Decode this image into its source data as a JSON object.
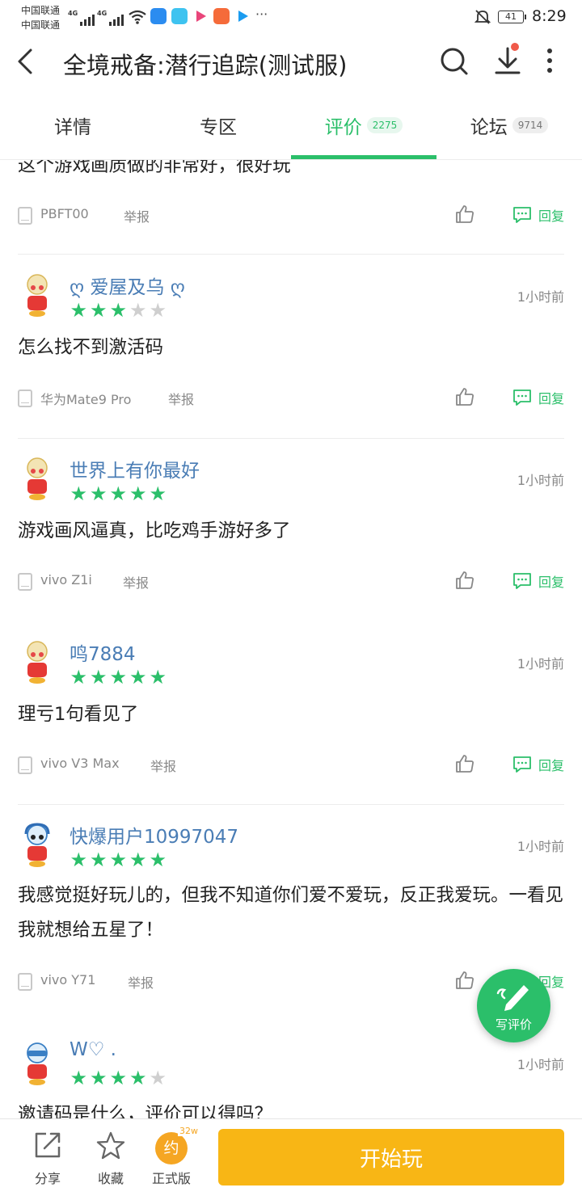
{
  "status_bar": {
    "carrier_1": "中国联通",
    "carrier_2": "中国联通",
    "net_1": "4G",
    "net_2": "4G",
    "more": "···",
    "battery": "41",
    "time": "8:29"
  },
  "title_bar": {
    "title": "全境戒备:潜行追踪(测试服)"
  },
  "tabs": [
    {
      "label": "详情",
      "count": ""
    },
    {
      "label": "专区",
      "count": ""
    },
    {
      "label": "评价",
      "count": "2275",
      "active": true
    },
    {
      "label": "论坛",
      "count": "9714"
    }
  ],
  "report_label": "举报",
  "reply_label": "回复",
  "reviews": [
    {
      "body": "这个游戏画质做的非常好，很好玩",
      "device": "PBFT00"
    },
    {
      "username": "ღ 爱屋及乌 ღ",
      "rating": 3,
      "time": "1小时前",
      "body": "怎么找不到激活码",
      "device": "华为Mate9 Pro"
    },
    {
      "username": "世界上有你最好",
      "rating": 5,
      "time": "1小时前",
      "body": "游戏画风逼真，比吃鸡手游好多了",
      "device": "vivo Z1i"
    },
    {
      "username": "鸣7884",
      "rating": 5,
      "time": "1小时前",
      "body": "理亏1句看见了",
      "device": "vivo V3 Max"
    },
    {
      "username": "快爆用户10997047",
      "rating": 5,
      "time": "1小时前",
      "body": "我感觉挺好玩儿的，但我不知道你们爱不爱玩，反正我爱玩。一看见我就想给五星了！",
      "device": "vivo Y71"
    },
    {
      "username": "W♡ .",
      "rating": 4,
      "time": "1小时前",
      "body": "邀请码是什么，评价可以得吗？"
    }
  ],
  "fab": {
    "label": "写评价"
  },
  "bottom_bar": {
    "share": "分享",
    "favorite": "收藏",
    "yue": "约",
    "yue_badge": "32w",
    "official": "正式版",
    "play": "开始玩"
  },
  "colors": {
    "accent_green": "#2bbf6a",
    "username_blue": "#4a7db5",
    "play_orange": "#f8b615"
  }
}
